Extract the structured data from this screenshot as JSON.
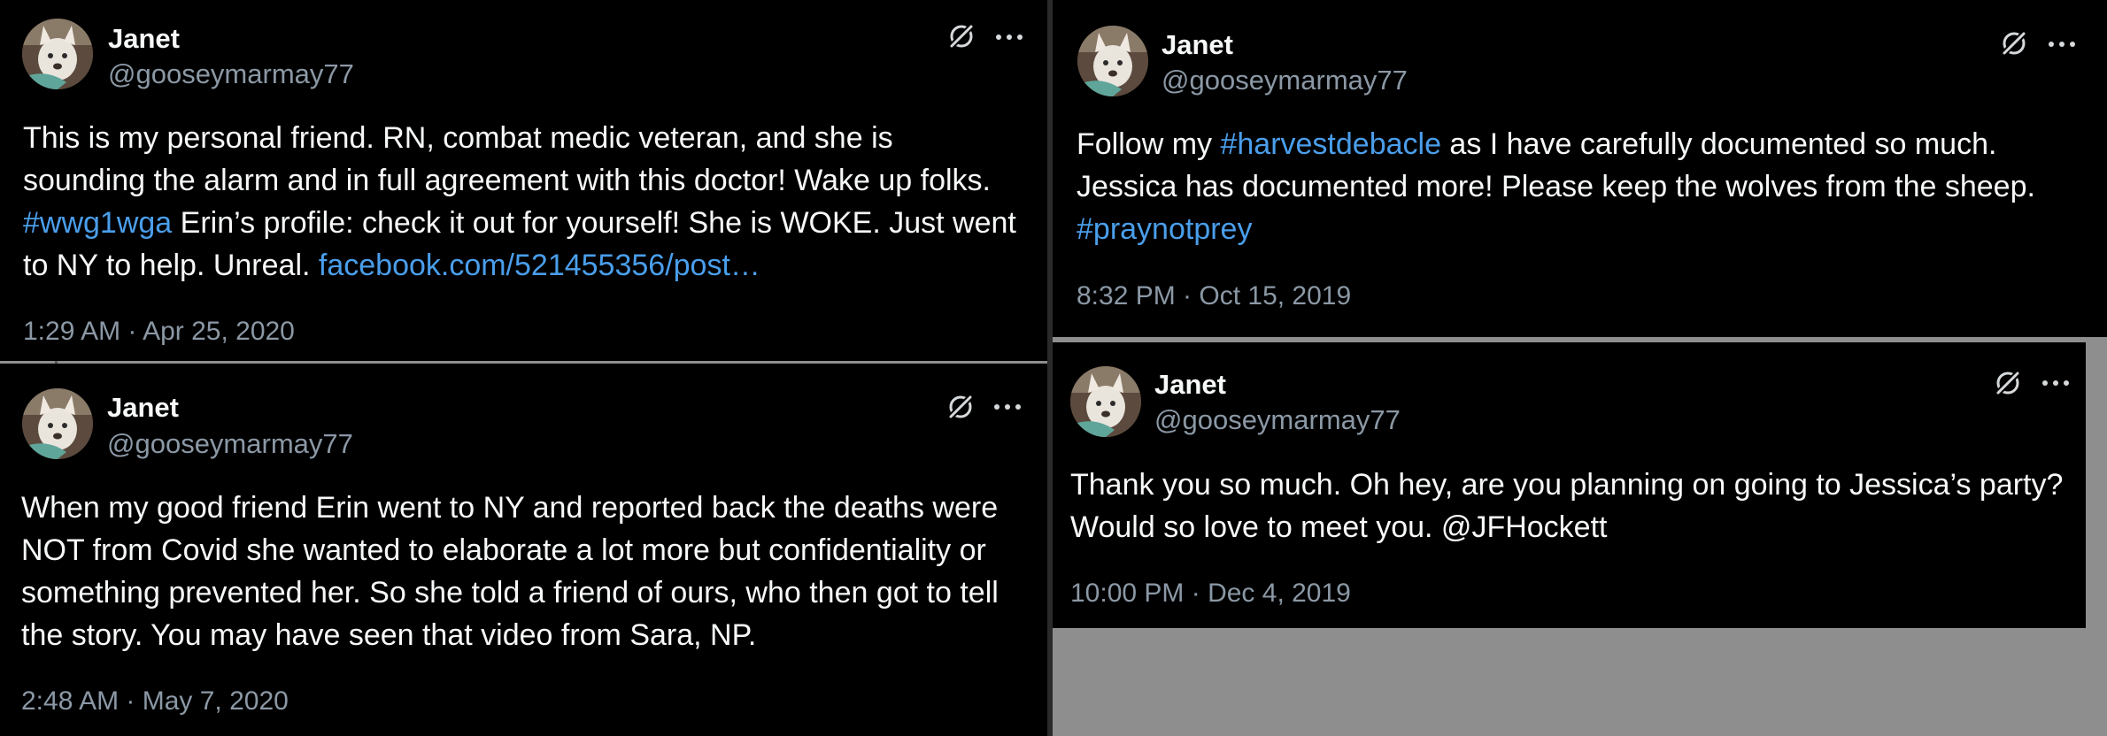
{
  "tweets": [
    {
      "name": "Janet",
      "handle": "@gooseymarmay77",
      "lines": [
        [
          {
            "t": "This is my personal friend. RN, combat medic veteran, and she is"
          }
        ],
        [
          {
            "t": "sounding the alarm and in full agreement with this doctor! Wake up folks."
          }
        ],
        [
          {
            "t": "#wwg1wga",
            "link": true
          },
          {
            "t": " Erin’s profile: check it out for yourself! She is WOKE. Just went"
          }
        ],
        [
          {
            "t": "to NY to help. Unreal.  "
          },
          {
            "t": "facebook.com/521455356/post…",
            "link": true
          }
        ]
      ],
      "timestamp": "1:29 AM · Apr 25, 2020"
    },
    {
      "name": "Janet",
      "handle": "@gooseymarmay77",
      "lines": [
        [
          {
            "t": "When my good friend Erin went to NY and reported back the deaths were"
          }
        ],
        [
          {
            "t": "NOT from Covid she wanted to elaborate a lot more but confidentiality or"
          }
        ],
        [
          {
            "t": "something prevented her. So she told a friend of ours, who then got to tell"
          }
        ],
        [
          {
            "t": "the story. You may have seen that video from Sara, NP."
          }
        ]
      ],
      "timestamp": "2:48 AM · May 7, 2020"
    },
    {
      "name": "Janet",
      "handle": "@gooseymarmay77",
      "lines": [
        [
          {
            "t": "Follow my "
          },
          {
            "t": "#harvestdebacle",
            "link": true
          },
          {
            "t": " as I have carefully documented so much."
          }
        ],
        [
          {
            "t": "Jessica has documented more! Please keep the wolves from the sheep."
          }
        ],
        [
          {
            "t": "#praynotprey",
            "link": true
          }
        ]
      ],
      "timestamp": "8:32 PM · Oct 15, 2019"
    },
    {
      "name": "Janet",
      "handle": "@gooseymarmay77",
      "lines": [
        [
          {
            "t": "Thank you so much. Oh hey, are you planning on going to Jessica’s party?"
          }
        ],
        [
          {
            "t": "Would so love to meet you. @JFHockett"
          }
        ]
      ],
      "timestamp": "10:00 PM · Dec 4, 2019"
    }
  ],
  "icons": {
    "avatar": "dog-avatar",
    "share": "x-logo-icon",
    "more": "more-options-icon"
  },
  "colors": {
    "background": "#000000",
    "text": "#f7f9f9",
    "muted": "#8b98a5",
    "link": "#4a9eeb",
    "canvas": "#8e8e8e"
  }
}
